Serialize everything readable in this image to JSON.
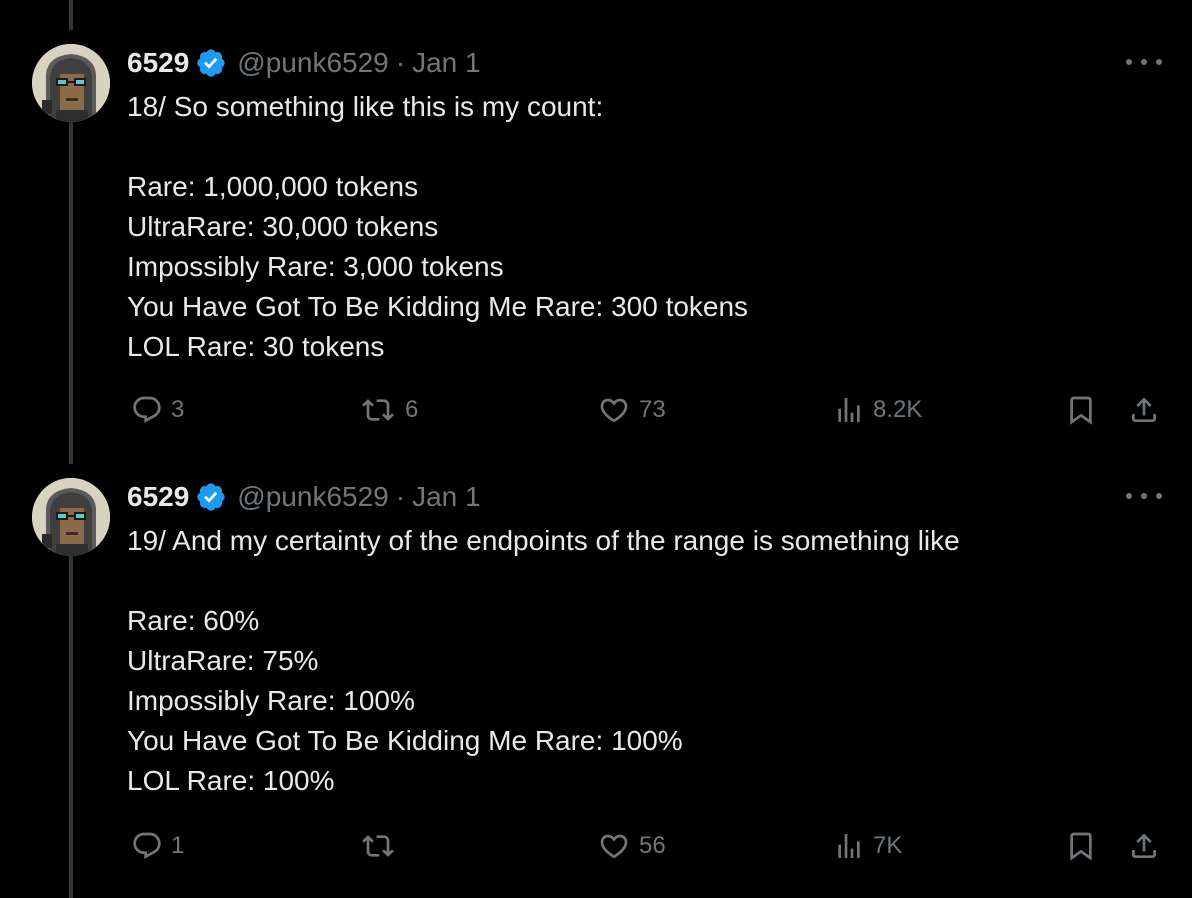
{
  "colors": {
    "background": "#000000",
    "text": "#e7e9ea",
    "muted": "#71767b",
    "verified": "#1d9bf0",
    "thread_line": "#333639"
  },
  "tweets": [
    {
      "author": {
        "name": "6529",
        "handle": "@punk6529",
        "verified": true
      },
      "date": "Jan 1",
      "separator": "·",
      "body": "18/ So something like this is my count:\n\nRare: 1,000,000 tokens\nUltraRare: 30,000 tokens\nImpossibly Rare: 3,000 tokens\nYou Have Got To Be Kidding Me Rare: 300 tokens\nLOL Rare: 30 tokens",
      "stats": {
        "replies": "3",
        "reposts": "6",
        "likes": "73",
        "views": "8.2K"
      }
    },
    {
      "author": {
        "name": "6529",
        "handle": "@punk6529",
        "verified": true
      },
      "date": "Jan 1",
      "separator": "·",
      "body": "19/ And my certainty of the endpoints of the range is something like\n\nRare: 60%\nUltraRare: 75%\nImpossibly Rare: 100%\nYou Have Got To Be Kidding Me Rare: 100%\nLOL Rare: 100%",
      "stats": {
        "replies": "1",
        "reposts": "",
        "likes": "56",
        "views": "7K"
      }
    }
  ],
  "icons": {
    "verified": "verified-badge-icon",
    "more": "more-dots-icon",
    "reply": "reply-icon",
    "repost": "repost-icon",
    "like": "heart-icon",
    "views": "views-chart-icon",
    "bookmark": "bookmark-icon",
    "share": "share-icon"
  }
}
